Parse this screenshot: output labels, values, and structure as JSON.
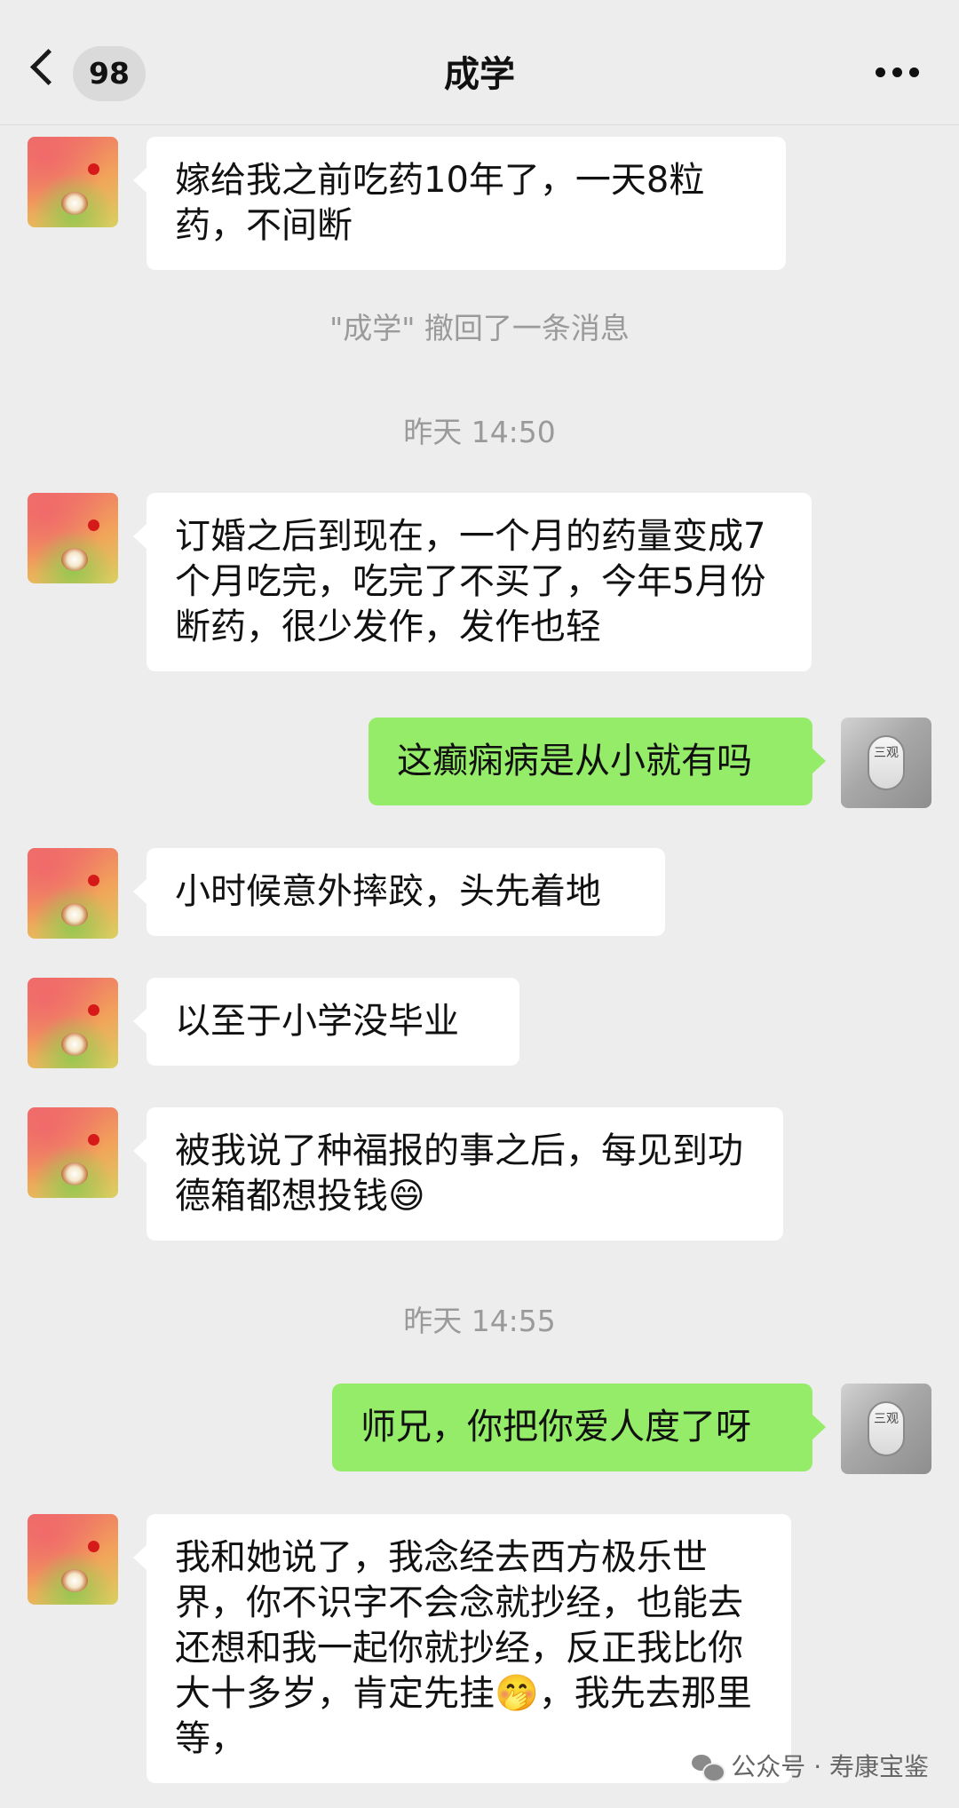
{
  "header": {
    "unread_count": "98",
    "title": "成学",
    "back_icon": "chevron-left-icon",
    "more_icon": "more-dots-icon"
  },
  "contact_avatar": {
    "icon": "contact-avatar-red-flower"
  },
  "self_avatar": {
    "icon": "self-avatar-stone-tile",
    "text": "三观"
  },
  "messages": [
    {
      "from": "contact",
      "text": "嫁给我之前吃药10年了，一天8粒药，不间断"
    },
    {
      "type": "system",
      "text": "\"成学\" 撤回了一条消息"
    },
    {
      "type": "time",
      "text": "昨天 14:50"
    },
    {
      "from": "contact",
      "text": "订婚之后到现在，一个月的药量变成7个月吃完，吃完了不买了，今年5月份断药，很少发作，发作也轻"
    },
    {
      "from": "self",
      "text": "这癫痫病是从小就有吗"
    },
    {
      "from": "contact",
      "text": "小时候意外摔跤，头先着地"
    },
    {
      "from": "contact",
      "text": "以至于小学没毕业"
    },
    {
      "from": "contact",
      "text": "被我说了种福报的事之后，每见到功德箱都想投钱😄"
    },
    {
      "type": "time",
      "text": "昨天 14:55"
    },
    {
      "from": "self",
      "text": "师兄，你把你爱人度了呀"
    },
    {
      "from": "contact",
      "text": "我和她说了，我念经去西方极乐世界，你不识字不会念就抄经，也能去还想和我一起你就抄经，反正我比你大十多岁，肯定先挂🤭，我先去那里等，"
    }
  ],
  "watermark": {
    "text": "公众号 · 寿康宝鉴",
    "icon": "wechat-icon"
  },
  "colors": {
    "background": "#ededed",
    "incoming_bubble": "#ffffff",
    "outgoing_bubble": "#95ec69",
    "system_text": "#9a9a9a"
  }
}
